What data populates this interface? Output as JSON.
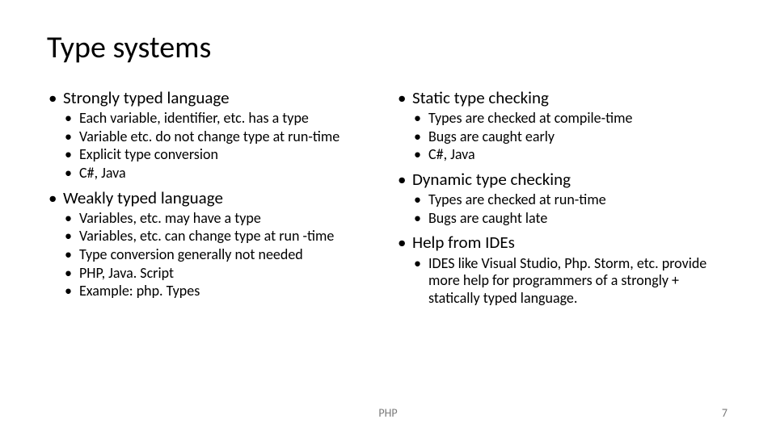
{
  "title": "Type systems",
  "left": {
    "items": [
      {
        "label": "Strongly typed language",
        "subs": [
          "Each variable, identifier, etc. has a type",
          "Variable etc. do not change type at run-time",
          "Explicit type conversion",
          "C#, Java"
        ]
      },
      {
        "label": "Weakly typed language",
        "subs": [
          "Variables, etc. may have a type",
          "Variables, etc. can change type at run -time",
          "Type conversion generally not needed",
          "PHP, Java. Script",
          "Example: php. Types"
        ]
      }
    ]
  },
  "right": {
    "items": [
      {
        "label": "Static type checking",
        "subs": [
          "Types are checked at compile-time",
          "Bugs are caught early",
          "C#, Java"
        ]
      },
      {
        "label": "Dynamic type checking",
        "subs": [
          "Types are checked at run-time",
          "Bugs are caught late"
        ]
      },
      {
        "label": "Help from IDEs",
        "subs": [
          "IDES like Visual Studio, Php. Storm,  etc. provide more help for programmers of a strongly + statically typed language."
        ]
      }
    ]
  },
  "footer": {
    "center": "PHP",
    "right": "7"
  }
}
